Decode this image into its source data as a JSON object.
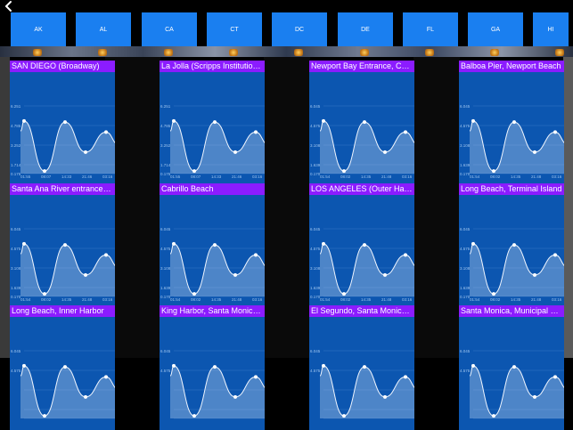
{
  "nav": {
    "back_icon": "chevron-left-icon"
  },
  "states": [
    "AK",
    "AL",
    "CA",
    "CT",
    "DC",
    "DE",
    "FL",
    "GA",
    "HI"
  ],
  "stations": [
    {
      "name": "SAN DIEGO (Broadway)",
      "yticks": [
        "6.251",
        "4.785",
        "3.252",
        "1.714",
        "0.175"
      ],
      "xticks": [
        "01:55",
        "08:07",
        "14:33",
        "21:46",
        "03:16"
      ]
    },
    {
      "name": "La Jolla (Scripps Institution Pier)",
      "yticks": [
        "6.251",
        "4.785",
        "3.252",
        "1.714",
        "0.175"
      ],
      "xticks": [
        "01:55",
        "08:07",
        "14:33",
        "21:46",
        "03:16"
      ]
    },
    {
      "name": "Newport Bay Entrance, Corona del Mar",
      "yticks": [
        "6.045",
        "4.575",
        "3.108",
        "1.639",
        "0.170"
      ],
      "xticks": [
        "01:54",
        "08:02",
        "14:35",
        "21:48",
        "03:16"
      ]
    },
    {
      "name": "Balboa Pier, Newport Beach",
      "yticks": [
        "6.045",
        "4.575",
        "3.108",
        "1.639",
        "0.170"
      ],
      "xticks": [
        "01:54",
        "08:02",
        "14:35",
        "21:48",
        "03:16"
      ]
    },
    {
      "name": "Santa Ana River entrance (inside)",
      "yticks": [
        "6.045",
        "4.575",
        "3.108",
        "1.639",
        "0.170"
      ],
      "xticks": [
        "01:54",
        "08:02",
        "14:35",
        "21:48",
        "03:16"
      ]
    },
    {
      "name": "Cabrillo Beach",
      "yticks": [
        "6.045",
        "4.575",
        "3.108",
        "1.639",
        "0.170"
      ],
      "xticks": [
        "01:54",
        "08:02",
        "14:35",
        "21:48",
        "03:16"
      ]
    },
    {
      "name": "LOS ANGELES (Outer Harbor)",
      "yticks": [
        "6.045",
        "4.575",
        "3.108",
        "1.639",
        "0.170"
      ],
      "xticks": [
        "01:54",
        "08:02",
        "14:35",
        "21:48",
        "03:16"
      ]
    },
    {
      "name": "Long Beach, Terminal Island",
      "yticks": [
        "6.045",
        "4.575",
        "3.108",
        "1.639",
        "0.170"
      ],
      "xticks": [
        "01:54",
        "08:02",
        "14:35",
        "21:48",
        "03:16"
      ]
    },
    {
      "name": "Long Beach, Inner Harbor",
      "yticks": [
        "6.045",
        "4.575"
      ],
      "xticks": []
    },
    {
      "name": "King Harbor, Santa Monica Bay",
      "yticks": [
        "6.045",
        "4.575"
      ],
      "xticks": []
    },
    {
      "name": "El Segundo, Santa Monica Bay",
      "yticks": [
        "6.045",
        "4.575"
      ],
      "xticks": []
    },
    {
      "name": "Santa Monica, Municipal Pier",
      "yticks": [
        "6.045",
        "4.575"
      ],
      "xticks": []
    }
  ],
  "tide_curve": [
    4.9,
    0.4,
    4.8,
    2.1,
    3.9
  ],
  "colors": {
    "state_button": "#1a7ff0",
    "title_bar": "#8b1cff",
    "chart_bg": "#0c56b0"
  }
}
